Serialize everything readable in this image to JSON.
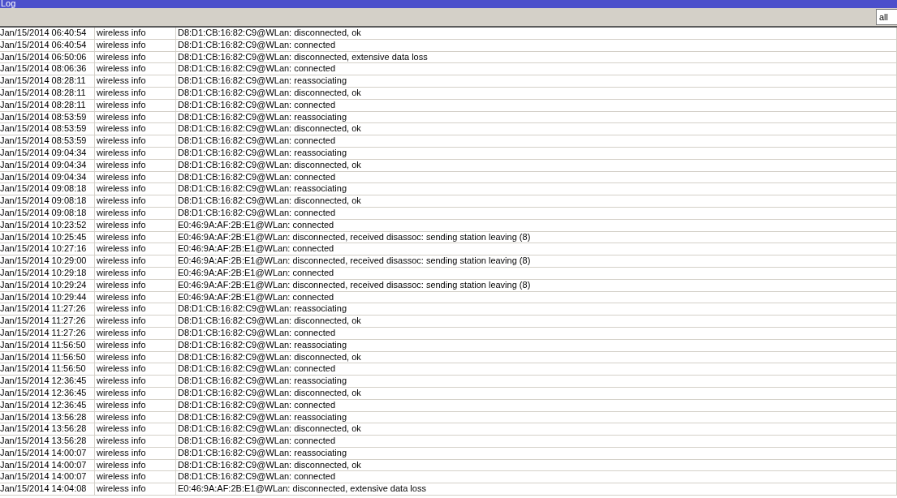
{
  "window": {
    "title": "Log"
  },
  "toolbar": {
    "filter": {
      "value": "all"
    }
  },
  "rows": [
    {
      "time": "Jan/15/2014 06:40:54",
      "topic": "wireless info",
      "message": "D8:D1:CB:16:82:C9@WLan: disconnected, ok"
    },
    {
      "time": "Jan/15/2014 06:40:54",
      "topic": "wireless info",
      "message": "D8:D1:CB:16:82:C9@WLan: connected"
    },
    {
      "time": "Jan/15/2014 06:50:06",
      "topic": "wireless info",
      "message": "D8:D1:CB:16:82:C9@WLan: disconnected, extensive data loss"
    },
    {
      "time": "Jan/15/2014 08:06:36",
      "topic": "wireless info",
      "message": "D8:D1:CB:16:82:C9@WLan: connected"
    },
    {
      "time": "Jan/15/2014 08:28:11",
      "topic": "wireless info",
      "message": "D8:D1:CB:16:82:C9@WLan: reassociating"
    },
    {
      "time": "Jan/15/2014 08:28:11",
      "topic": "wireless info",
      "message": "D8:D1:CB:16:82:C9@WLan: disconnected, ok"
    },
    {
      "time": "Jan/15/2014 08:28:11",
      "topic": "wireless info",
      "message": "D8:D1:CB:16:82:C9@WLan: connected"
    },
    {
      "time": "Jan/15/2014 08:53:59",
      "topic": "wireless info",
      "message": "D8:D1:CB:16:82:C9@WLan: reassociating"
    },
    {
      "time": "Jan/15/2014 08:53:59",
      "topic": "wireless info",
      "message": "D8:D1:CB:16:82:C9@WLan: disconnected, ok"
    },
    {
      "time": "Jan/15/2014 08:53:59",
      "topic": "wireless info",
      "message": "D8:D1:CB:16:82:C9@WLan: connected"
    },
    {
      "time": "Jan/15/2014 09:04:34",
      "topic": "wireless info",
      "message": "D8:D1:CB:16:82:C9@WLan: reassociating"
    },
    {
      "time": "Jan/15/2014 09:04:34",
      "topic": "wireless info",
      "message": "D8:D1:CB:16:82:C9@WLan: disconnected, ok"
    },
    {
      "time": "Jan/15/2014 09:04:34",
      "topic": "wireless info",
      "message": "D8:D1:CB:16:82:C9@WLan: connected"
    },
    {
      "time": "Jan/15/2014 09:08:18",
      "topic": "wireless info",
      "message": "D8:D1:CB:16:82:C9@WLan: reassociating"
    },
    {
      "time": "Jan/15/2014 09:08:18",
      "topic": "wireless info",
      "message": "D8:D1:CB:16:82:C9@WLan: disconnected, ok"
    },
    {
      "time": "Jan/15/2014 09:08:18",
      "topic": "wireless info",
      "message": "D8:D1:CB:16:82:C9@WLan: connected"
    },
    {
      "time": "Jan/15/2014 10:23:52",
      "topic": "wireless info",
      "message": "E0:46:9A:AF:2B:E1@WLan: connected"
    },
    {
      "time": "Jan/15/2014 10:25:45",
      "topic": "wireless info",
      "message": "E0:46:9A:AF:2B:E1@WLan: disconnected, received disassoc: sending station leaving (8)"
    },
    {
      "time": "Jan/15/2014 10:27:16",
      "topic": "wireless info",
      "message": "E0:46:9A:AF:2B:E1@WLan: connected"
    },
    {
      "time": "Jan/15/2014 10:29:00",
      "topic": "wireless info",
      "message": "E0:46:9A:AF:2B:E1@WLan: disconnected, received disassoc: sending station leaving (8)"
    },
    {
      "time": "Jan/15/2014 10:29:18",
      "topic": "wireless info",
      "message": "E0:46:9A:AF:2B:E1@WLan: connected"
    },
    {
      "time": "Jan/15/2014 10:29:24",
      "topic": "wireless info",
      "message": "E0:46:9A:AF:2B:E1@WLan: disconnected, received disassoc: sending station leaving (8)"
    },
    {
      "time": "Jan/15/2014 10:29:44",
      "topic": "wireless info",
      "message": "E0:46:9A:AF:2B:E1@WLan: connected"
    },
    {
      "time": "Jan/15/2014 11:27:26",
      "topic": "wireless info",
      "message": "D8:D1:CB:16:82:C9@WLan: reassociating"
    },
    {
      "time": "Jan/15/2014 11:27:26",
      "topic": "wireless info",
      "message": "D8:D1:CB:16:82:C9@WLan: disconnected, ok"
    },
    {
      "time": "Jan/15/2014 11:27:26",
      "topic": "wireless info",
      "message": "D8:D1:CB:16:82:C9@WLan: connected"
    },
    {
      "time": "Jan/15/2014 11:56:50",
      "topic": "wireless info",
      "message": "D8:D1:CB:16:82:C9@WLan: reassociating"
    },
    {
      "time": "Jan/15/2014 11:56:50",
      "topic": "wireless info",
      "message": "D8:D1:CB:16:82:C9@WLan: disconnected, ok"
    },
    {
      "time": "Jan/15/2014 11:56:50",
      "topic": "wireless info",
      "message": "D8:D1:CB:16:82:C9@WLan: connected"
    },
    {
      "time": "Jan/15/2014 12:36:45",
      "topic": "wireless info",
      "message": "D8:D1:CB:16:82:C9@WLan: reassociating"
    },
    {
      "time": "Jan/15/2014 12:36:45",
      "topic": "wireless info",
      "message": "D8:D1:CB:16:82:C9@WLan: disconnected, ok"
    },
    {
      "time": "Jan/15/2014 12:36:45",
      "topic": "wireless info",
      "message": "D8:D1:CB:16:82:C9@WLan: connected"
    },
    {
      "time": "Jan/15/2014 13:56:28",
      "topic": "wireless info",
      "message": "D8:D1:CB:16:82:C9@WLan: reassociating"
    },
    {
      "time": "Jan/15/2014 13:56:28",
      "topic": "wireless info",
      "message": "D8:D1:CB:16:82:C9@WLan: disconnected, ok"
    },
    {
      "time": "Jan/15/2014 13:56:28",
      "topic": "wireless info",
      "message": "D8:D1:CB:16:82:C9@WLan: connected"
    },
    {
      "time": "Jan/15/2014 14:00:07",
      "topic": "wireless info",
      "message": "D8:D1:CB:16:82:C9@WLan: reassociating"
    },
    {
      "time": "Jan/15/2014 14:00:07",
      "topic": "wireless info",
      "message": "D8:D1:CB:16:82:C9@WLan: disconnected, ok"
    },
    {
      "time": "Jan/15/2014 14:00:07",
      "topic": "wireless info",
      "message": "D8:D1:CB:16:82:C9@WLan: connected"
    },
    {
      "time": "Jan/15/2014 14:04:08",
      "topic": "wireless info",
      "message": "E0:46:9A:AF:2B:E1@WLan: disconnected, extensive data loss"
    }
  ]
}
